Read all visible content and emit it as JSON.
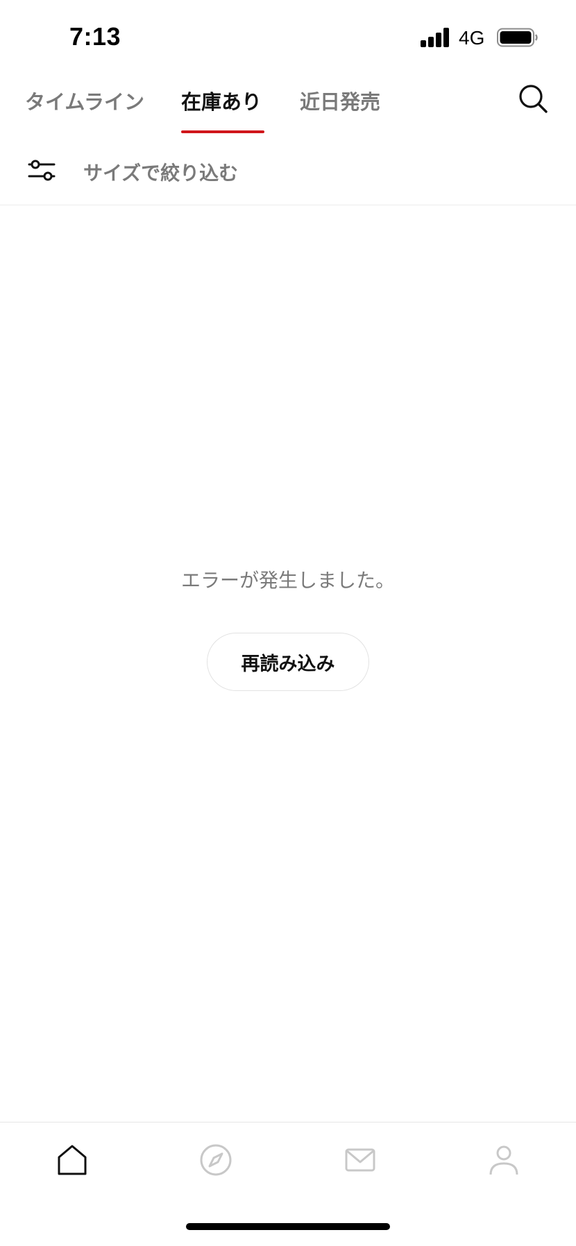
{
  "status_bar": {
    "time": "7:13",
    "network": "4G"
  },
  "tabs": [
    {
      "label": "タイムライン",
      "active": false
    },
    {
      "label": "在庫あり",
      "active": true
    },
    {
      "label": "近日発売",
      "active": false
    }
  ],
  "filter": {
    "label": "サイズで絞り込む"
  },
  "error": {
    "message": "エラーが発生しました。",
    "reload_label": "再読み込み"
  },
  "bottom_nav": [
    {
      "name": "home",
      "icon": "home-icon",
      "active": true
    },
    {
      "name": "discover",
      "icon": "compass-icon",
      "active": false
    },
    {
      "name": "messages",
      "icon": "mail-icon",
      "active": false
    },
    {
      "name": "profile",
      "icon": "user-icon",
      "active": false
    }
  ],
  "colors": {
    "accent": "#d0161b",
    "inactive_text": "#7a7a7a",
    "active_text": "#111111",
    "inactive_icon": "#c8c8c8"
  }
}
